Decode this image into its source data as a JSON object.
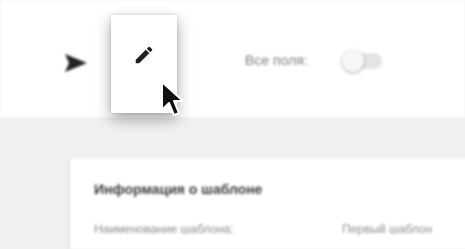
{
  "toolbar": {
    "send_icon": "send-icon",
    "edit_icon": "pencil-icon",
    "all_fields_label": "Все поля:",
    "all_fields_enabled": false
  },
  "template_info": {
    "title": "Информация о шаблоне",
    "name_label": "Наименование шаблона:",
    "name_value": "Первый шаблон"
  },
  "colors": {
    "toolbar_bg": "#ffffff",
    "page_bg": "#f1f1f1",
    "icon": "#222222"
  }
}
